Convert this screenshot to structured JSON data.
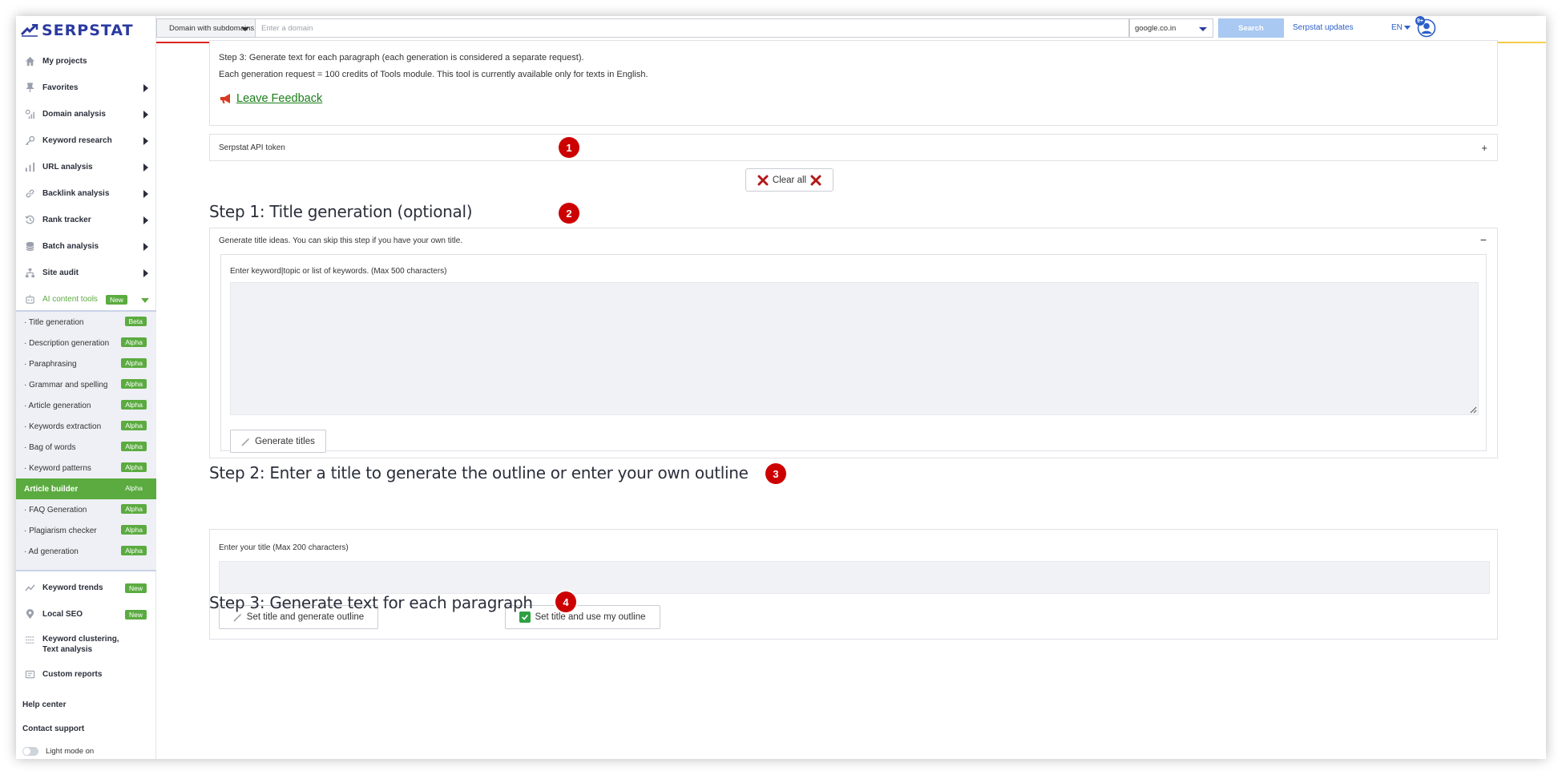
{
  "brand": {
    "name": "SERPSTAT",
    "color": "#2b3aa0"
  },
  "colors": {
    "accent_green": "#5bab40",
    "marker_red": "#cc0000",
    "link_blue": "#2b5fc7",
    "search_btn": "#a9c8f2"
  },
  "topbar": {
    "domain_type": "Domain with subdomains",
    "domain_placeholder": "Enter a domain",
    "search_engine": "google.co.in",
    "search_label": "Search",
    "updates_label": "Serpstat updates",
    "language": "EN",
    "notifications_badge": "9+"
  },
  "sidebar": {
    "items": [
      {
        "label": "My projects",
        "icon": "home-icon",
        "has_arrow": false
      },
      {
        "label": "Favorites",
        "icon": "pin-icon",
        "has_arrow": true
      },
      {
        "label": "Domain analysis",
        "icon": "domain-icon",
        "has_arrow": true
      },
      {
        "label": "Keyword research",
        "icon": "key-icon",
        "has_arrow": true
      },
      {
        "label": "URL analysis",
        "icon": "bar-chart-icon",
        "has_arrow": true
      },
      {
        "label": "Backlink analysis",
        "icon": "link-icon",
        "has_arrow": true
      },
      {
        "label": "Rank tracker",
        "icon": "history-icon",
        "has_arrow": true
      },
      {
        "label": "Batch analysis",
        "icon": "database-icon",
        "has_arrow": true
      },
      {
        "label": "Site audit",
        "icon": "sitemap-icon",
        "has_arrow": true
      }
    ],
    "ai_tools": {
      "label": "AI content tools",
      "badge": "New"
    },
    "ai_sub": [
      {
        "label": "· Title generation",
        "badge": "Beta"
      },
      {
        "label": "· Description generation",
        "badge": "Alpha"
      },
      {
        "label": "· Paraphrasing",
        "badge": "Alpha"
      },
      {
        "label": "· Grammar and spelling",
        "badge": "Alpha"
      },
      {
        "label": "· Article generation",
        "badge": "Alpha"
      },
      {
        "label": "· Keywords extraction",
        "badge": "Alpha"
      },
      {
        "label": "· Bag of words",
        "badge": "Alpha"
      },
      {
        "label": "· Keyword patterns",
        "badge": "Alpha"
      },
      {
        "label": "Article builder",
        "badge": "Alpha",
        "active": true
      },
      {
        "label": "· FAQ Generation",
        "badge": "Alpha"
      },
      {
        "label": "· Plagiarism checker",
        "badge": "Alpha"
      },
      {
        "label": "· Ad generation",
        "badge": "Alpha"
      }
    ],
    "items2": [
      {
        "label": "Keyword trends",
        "badge": "New",
        "icon": "trend-icon"
      },
      {
        "label": "Local SEO",
        "badge": "New",
        "icon": "map-pin-icon"
      },
      {
        "label": "Keyword clustering, Text analysis",
        "badge": "",
        "icon": "clustering-icon"
      },
      {
        "label": "Custom reports",
        "badge": "",
        "icon": "report-icon"
      }
    ],
    "help_center": "Help center",
    "contact_support": "Contact support",
    "light_mode": "Light mode on"
  },
  "intro": {
    "line1": "Step 3: Generate text for each paragraph (each generation is considered a separate request).",
    "line2": "Each generation request = 100 credits of Tools module. This tool is currently available only for texts in English.",
    "feedback": "Leave Feedback"
  },
  "api_token": {
    "label": "Serpstat API token",
    "toggle": "+"
  },
  "clear_all": "Clear all",
  "markers": [
    "1",
    "2",
    "3",
    "4"
  ],
  "step1": {
    "title": "Step 1: Title generation (optional)",
    "header": "Generate title ideas. You can skip this step if you have your own title.",
    "collapse": "−",
    "input_label": "Enter keyword|topic or list of keywords. (Max 500 characters)",
    "textarea_value": "",
    "button": "Generate titles"
  },
  "step2": {
    "title": "Step 2: Enter a title to generate the outline or enter your own outline",
    "input_label": "Enter your title (Max 200 characters)",
    "input_value": "",
    "button_generate": "Set title and generate outline",
    "button_use_own": "Set title and use my outline"
  },
  "step3": {
    "title": "Step 3: Generate text for each paragraph"
  }
}
